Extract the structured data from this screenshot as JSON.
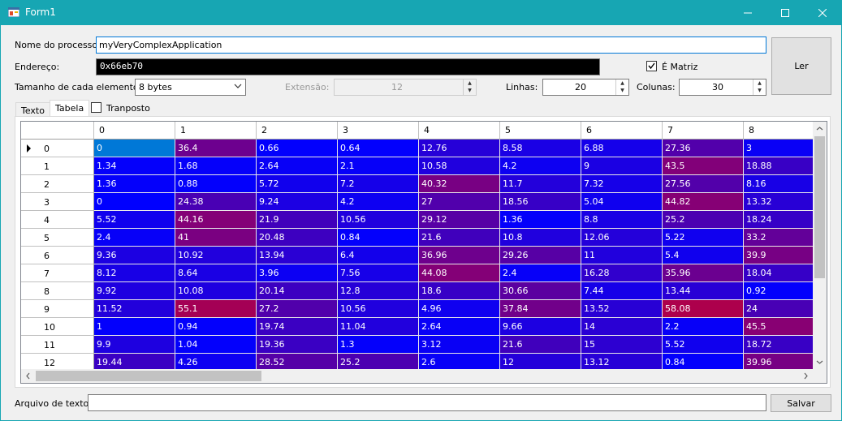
{
  "window": {
    "title": "Form1"
  },
  "form": {
    "process_label": "Nome do processo:",
    "process_value": "myVeryComplexApplication",
    "address_label": "Endereço:",
    "address_value": "0x66eb70",
    "matrix_label": "É Matriz",
    "matrix_checked": true,
    "read_button": "Ler",
    "elem_size_label": "Tamanho de cada elemento:",
    "elem_size_value": "8 bytes",
    "extension_label": "Extensão:",
    "extension_value": "12",
    "lines_label": "Linhas:",
    "lines_value": "20",
    "cols_label": "Colunas:",
    "cols_value": "30"
  },
  "tabs": [
    {
      "label": "Texto"
    },
    {
      "label": "Tabela"
    }
  ],
  "transposed_label": "Tranposto",
  "table": {
    "columns": [
      "0",
      "1",
      "2",
      "3",
      "4",
      "5",
      "6",
      "7",
      "8"
    ],
    "rows": [
      {
        "h": "0",
        "v": [
          "0",
          "36.4",
          "0.66",
          "0.64",
          "12.76",
          "8.58",
          "6.88",
          "27.36",
          "3"
        ]
      },
      {
        "h": "1",
        "v": [
          "1.34",
          "1.68",
          "2.64",
          "2.1",
          "10.58",
          "4.2",
          "9",
          "43.5",
          "18.88"
        ]
      },
      {
        "h": "2",
        "v": [
          "1.36",
          "0.88",
          "5.72",
          "7.2",
          "40.32",
          "11.7",
          "7.32",
          "27.56",
          "8.16"
        ]
      },
      {
        "h": "3",
        "v": [
          "0",
          "24.38",
          "9.24",
          "4.2",
          "27",
          "18.56",
          "5.04",
          "44.82",
          "13.32"
        ]
      },
      {
        "h": "4",
        "v": [
          "5.52",
          "44.16",
          "21.9",
          "10.56",
          "29.12",
          "1.36",
          "8.8",
          "25.2",
          "18.24"
        ]
      },
      {
        "h": "5",
        "v": [
          "2.4",
          "41",
          "20.48",
          "0.84",
          "21.6",
          "10.8",
          "12.06",
          "5.22",
          "33.2"
        ]
      },
      {
        "h": "6",
        "v": [
          "9.36",
          "10.92",
          "13.94",
          "6.4",
          "36.96",
          "29.26",
          "11",
          "5.4",
          "39.9"
        ]
      },
      {
        "h": "7",
        "v": [
          "8.12",
          "8.64",
          "3.96",
          "7.56",
          "44.08",
          "2.4",
          "16.28",
          "35.96",
          "18.04"
        ]
      },
      {
        "h": "8",
        "v": [
          "9.92",
          "10.08",
          "20.14",
          "12.8",
          "18.6",
          "30.66",
          "7.44",
          "13.44",
          "0.92"
        ]
      },
      {
        "h": "9",
        "v": [
          "11.52",
          "55.1",
          "27.2",
          "10.56",
          "4.96",
          "37.84",
          "13.52",
          "58.08",
          "24"
        ]
      },
      {
        "h": "10",
        "v": [
          "1",
          "0.94",
          "19.74",
          "11.04",
          "2.64",
          "9.66",
          "14",
          "2.2",
          "45.5"
        ]
      },
      {
        "h": "11",
        "v": [
          "9.9",
          "1.04",
          "19.36",
          "1.3",
          "3.12",
          "21.6",
          "15",
          "5.52",
          "18.72"
        ]
      },
      {
        "h": "12",
        "v": [
          "19.44",
          "4.26",
          "28.52",
          "25.2",
          "2.6",
          "12",
          "13.12",
          "0.84",
          "39.96"
        ]
      }
    ]
  },
  "file": {
    "label": "Arquivo de texto:",
    "value": "",
    "save_button": "Salvar"
  },
  "colors": {
    "titlebar": "#17a6b3",
    "low": "#0000ff",
    "high": "#b30046",
    "selected": "#0078d7"
  }
}
